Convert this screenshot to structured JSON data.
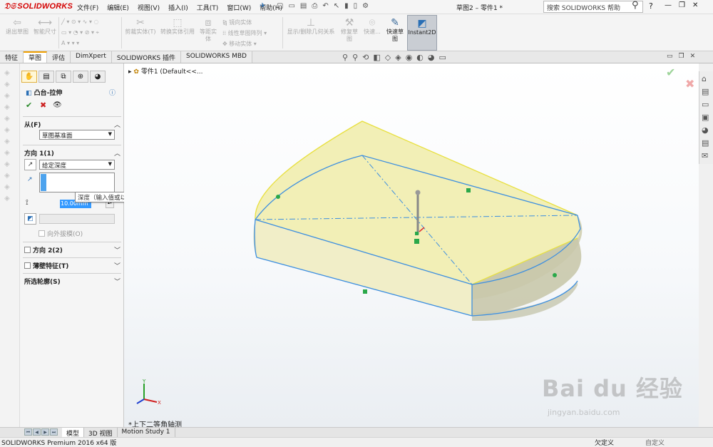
{
  "app": {
    "logo_text": "SOLIDWORKS",
    "doc_title": "草图2 – 零件1 *",
    "search_placeholder": "搜索 SOLIDWORKS 帮助"
  },
  "menu": [
    "文件(F)",
    "编辑(E)",
    "视图(V)",
    "插入(I)",
    "工具(T)",
    "窗口(W)",
    "帮助(H)"
  ],
  "ribbon": {
    "exit_sketch": "退出草图",
    "smart_dim": "智能尺寸",
    "trim": "剪裁实体(T)",
    "convert": "转换实体引用",
    "offset_l1": "等距实",
    "offset_l2": "体",
    "mirror": "镜向实体",
    "linear_pattern": "线性草图阵列",
    "move": "移动实体",
    "show_relations": "显示/删除几何关系",
    "repair_l1": "修复草",
    "repair_l2": "图",
    "quick_snaps": "快速...",
    "quick_sketch_l1": "快速草",
    "quick_sketch_l2": "图",
    "instant2d": "Instant2D"
  },
  "tabs": [
    "特征",
    "草图",
    "评估",
    "DimXpert",
    "SOLIDWORKS 插件",
    "SOLIDWORKS MBD"
  ],
  "active_tab": "草图",
  "property_manager": {
    "feature_title": "凸台-拉伸",
    "from_header": "从(F)",
    "from_value": "草图基准面",
    "dir1_header": "方向 1(1)",
    "end_condition": "给定深度",
    "depth_value": "10.00mm",
    "depth_tooltip": "深度（输入值或以 = 开始，以创建方程式）",
    "draft_outward": "向外拔模(O)",
    "dir2_header": "方向 2(2)",
    "thin_header": "薄壁特征(T)",
    "contours_header": "所选轮廓(S)"
  },
  "tree": {
    "root_label": "零件1 (Default<<..."
  },
  "view_label": "*上下二等角轴测",
  "bottom_tabs": [
    "模型",
    "3D 视图",
    "Motion Study 1"
  ],
  "active_bottom_tab": "模型",
  "status": {
    "product": "SOLIDWORKS Premium 2016 x64 版",
    "state": "欠定义",
    "custom": "自定义"
  },
  "watermark": {
    "brand": "Bai du 经验",
    "url": "jingyan.baidu.com"
  },
  "colors": {
    "model_face": "#f0ecb0",
    "edge_blue": "#3d8fe0",
    "edge_yellow": "#e8e040",
    "logo_red": "#d40000",
    "accent_orange": "#f0a000"
  }
}
